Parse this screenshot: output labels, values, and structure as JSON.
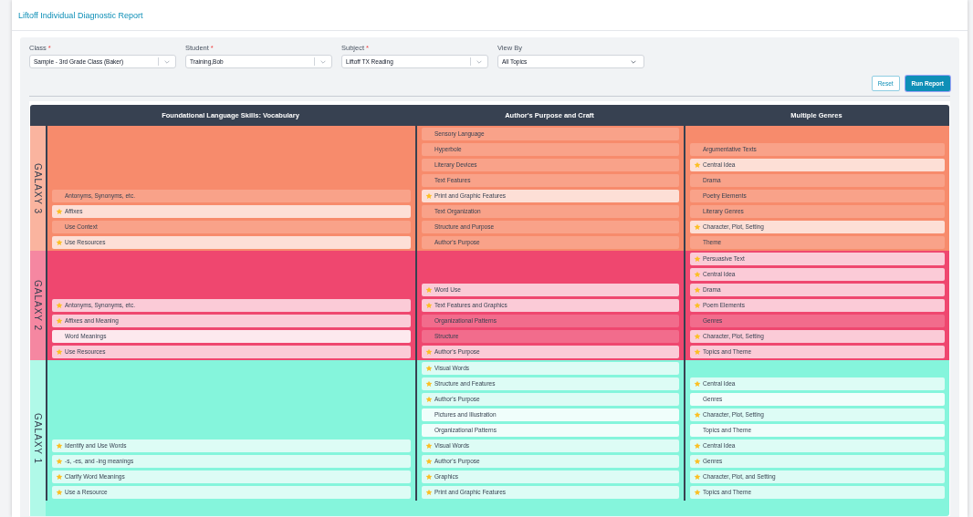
{
  "page": {
    "title": "Liftoff Individual Diagnostic Report"
  },
  "filters": [
    {
      "label": "Class",
      "marker": "*",
      "value": "Sample - 3rd Grade Class (Baker)",
      "kind": "combo"
    },
    {
      "label": "Student",
      "marker": "*",
      "value": "Training,Bob",
      "kind": "combo"
    },
    {
      "label": "Subject",
      "marker": "*",
      "value": "Liftoff TX Reading",
      "kind": "combo"
    },
    {
      "label": "View By",
      "value": "All Topics",
      "kind": "plain"
    }
  ],
  "buttons": [
    {
      "label": "Reset",
      "kind": "outline"
    },
    {
      "label": "Run Report",
      "kind": "primary"
    }
  ],
  "table": {
    "columns": [
      "Foundational Language Skills: Vocabulary",
      "Author's Purpose and Craft",
      "Multiple Genres"
    ],
    "galaxies": [
      {
        "label": "GALAXY 3",
        "color": "#f78b6c",
        "cells": [
          [
            {
              "label": "Antonyms, Synonyms, etc.",
              "kind": "plain"
            },
            {
              "label": "Affixes",
              "kind": "starred"
            },
            {
              "label": "Use Context",
              "kind": "plain"
            },
            {
              "label": "Use Resources",
              "kind": "starred"
            }
          ],
          [
            {
              "label": "Sensory Language",
              "kind": "plain"
            },
            {
              "label": "Hyperbole",
              "kind": "plain"
            },
            {
              "label": "Literary Devices",
              "kind": "plain"
            },
            {
              "label": "Text Features",
              "kind": "plain"
            },
            {
              "label": "Print and Graphic Features",
              "kind": "starred"
            },
            {
              "label": "Text Organization",
              "kind": "plain"
            },
            {
              "label": "Structure and Purpose",
              "kind": "plain"
            },
            {
              "label": "Author's Purpose",
              "kind": "plain"
            }
          ],
          [
            {
              "label": "Argumentative Texts",
              "kind": "plain"
            },
            {
              "label": "Central Idea",
              "kind": "starred"
            },
            {
              "label": "Drama",
              "kind": "plain"
            },
            {
              "label": "Poetry Elements",
              "kind": "plain"
            },
            {
              "label": "Literary Genres",
              "kind": "plain"
            },
            {
              "label": "Character, Plot, Setting",
              "kind": "starred"
            },
            {
              "label": "Theme",
              "kind": "plain"
            }
          ]
        ]
      },
      {
        "label": "GALAXY 2",
        "color": "#ef476f",
        "cells": [
          [
            {
              "label": "Antonyms, Synonyms, etc.",
              "kind": "starred"
            },
            {
              "label": "Affixes and Meaning",
              "kind": "starred"
            },
            {
              "label": "Word Meanings",
              "kind": "open"
            },
            {
              "label": "Use Resources",
              "kind": "starred"
            }
          ],
          [
            {
              "label": "Word Use",
              "kind": "starred"
            },
            {
              "label": "Text Features and Graphics",
              "kind": "starred"
            },
            {
              "label": "Organizational Patterns",
              "kind": "plain"
            },
            {
              "label": "Structure",
              "kind": "plain"
            },
            {
              "label": "Author's Purpose",
              "kind": "starred"
            }
          ],
          [
            {
              "label": "Persuasive Text",
              "kind": "starred"
            },
            {
              "label": "Central Idea",
              "kind": "starred"
            },
            {
              "label": "Drama",
              "kind": "starred"
            },
            {
              "label": "Poem Elements",
              "kind": "starred"
            },
            {
              "label": "Genres",
              "kind": "plain"
            },
            {
              "label": "Character, Plot, Setting",
              "kind": "starred"
            },
            {
              "label": "Topics and Theme",
              "kind": "starred"
            }
          ]
        ]
      },
      {
        "label": "GALAXY 1",
        "color": "#85f5dc",
        "cells": [
          [
            {
              "label": "Identify and Use Words",
              "kind": "starred"
            },
            {
              "label": "-s, -es, and -ing meanings",
              "kind": "starred"
            },
            {
              "label": "Clarify Word Meanings",
              "kind": "starred"
            },
            {
              "label": "Use a Resource",
              "kind": "starred"
            }
          ],
          [
            {
              "label": "Visual Words",
              "kind": "starred"
            },
            {
              "label": "Structure and Features",
              "kind": "starred"
            },
            {
              "label": "Author's Purpose",
              "kind": "starred"
            },
            {
              "label": "Pictures and Illustration",
              "kind": "open"
            },
            {
              "label": "Organizational Patterns",
              "kind": "open"
            },
            {
              "label": "Visual Words",
              "kind": "starred"
            },
            {
              "label": "Author's Purpose",
              "kind": "starred"
            },
            {
              "label": "Graphics",
              "kind": "starred"
            },
            {
              "label": "Print and Graphic Features",
              "kind": "starred"
            }
          ],
          [
            {
              "label": "Central Idea",
              "kind": "starred"
            },
            {
              "label": "Genres",
              "kind": "open"
            },
            {
              "label": "Character, Plot, Setting",
              "kind": "starred"
            },
            {
              "label": "Topics and Theme",
              "kind": "open"
            },
            {
              "label": "Central Idea",
              "kind": "starred"
            },
            {
              "label": "Genres",
              "kind": "starred"
            },
            {
              "label": "Character, Plot, and Setting",
              "kind": "starred"
            },
            {
              "label": "Topics and Theme",
              "kind": "starred"
            }
          ]
        ]
      }
    ]
  }
}
